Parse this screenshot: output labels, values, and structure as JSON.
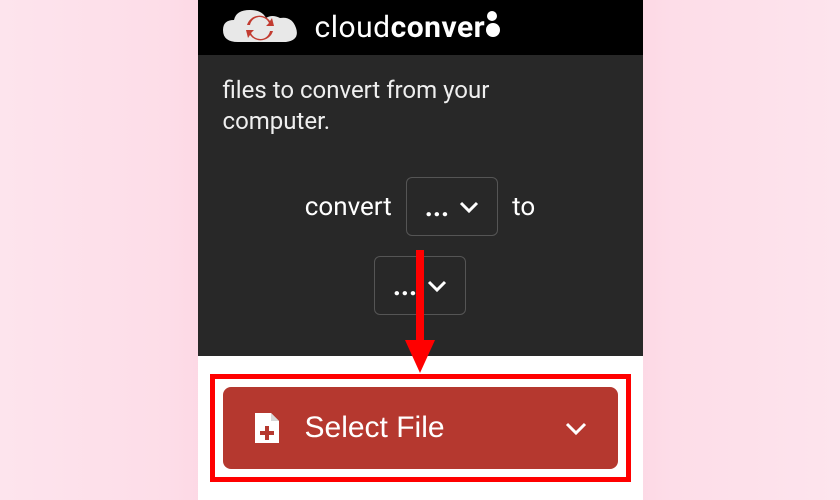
{
  "header": {
    "brand_light": "cloud",
    "brand_bold": "conver"
  },
  "instruction": {
    "line1": "files to convert from your",
    "line2": "computer."
  },
  "convert": {
    "label_from": "convert",
    "label_to": "to",
    "format_from": "...",
    "format_to": "..."
  },
  "select_file": {
    "label": "Select File"
  }
}
